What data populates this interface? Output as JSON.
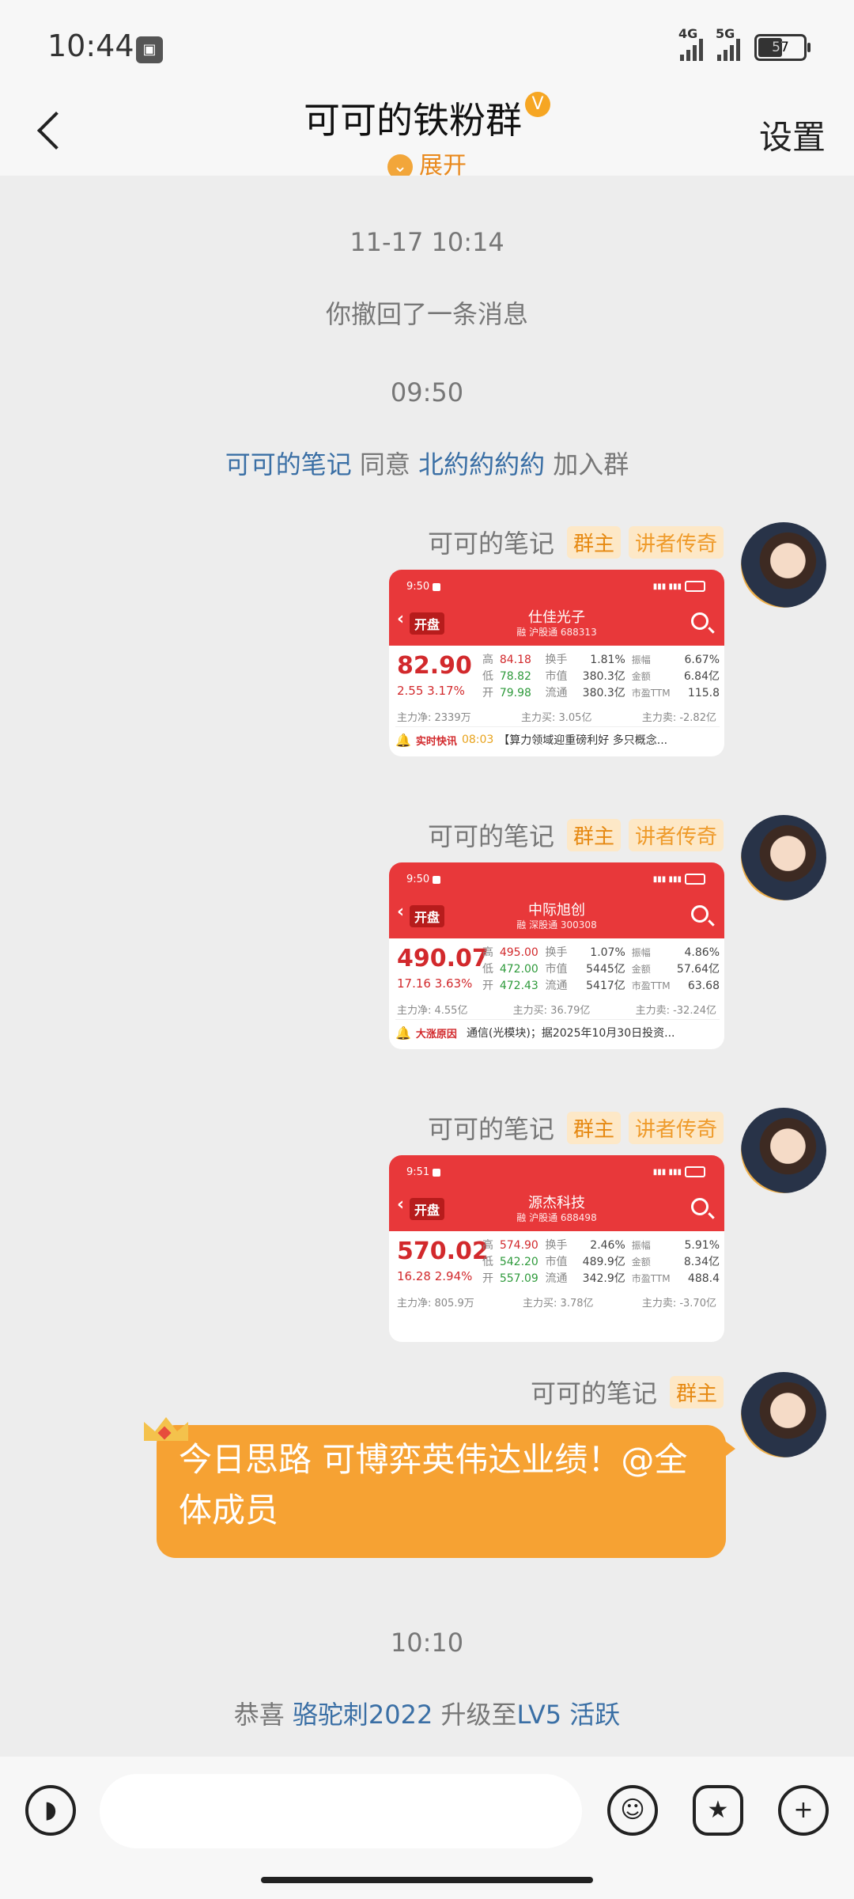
{
  "status": {
    "time": "10:44",
    "battery": "57",
    "sig1": "4G",
    "sig2": "5G",
    "notif_icon": "notification-icon"
  },
  "header": {
    "title": "可可的铁粉群",
    "verified_icon": "V",
    "expand_label": "展开",
    "settings_label": "设置"
  },
  "messages": {
    "time1": "11-17 10:14",
    "recall": "你撤回了一条消息",
    "time2": "09:50",
    "join": {
      "who": "可可的笔记",
      "verb": "同意",
      "target": "北約約約約",
      "tail": "加入群"
    },
    "sender_name": "可可的笔记",
    "badge_owner": "群主",
    "badge_speaker": "讲者传奇",
    "bubble_text": "今日思路  可博弈英伟达业绩！@全体成员",
    "time3": "10:10",
    "upgrade": {
      "prefix": "恭喜",
      "user": "骆驼刺2022",
      "mid": "升级至",
      "level": "LV5 活跃"
    }
  },
  "cards": [
    {
      "time": "9:50",
      "open": "开盘",
      "name": "仕佳光子",
      "market": "融 沪股通 688313",
      "price": "82.90",
      "change": "2.55  3.17%",
      "rows": [
        [
          "高",
          "84.18",
          "换手",
          "1.81%",
          "振幅",
          "6.67%"
        ],
        [
          "低",
          "78.82",
          "市值",
          "380.3亿",
          "金额",
          "6.84亿"
        ],
        [
          "开",
          "79.98",
          "流通",
          "380.3亿",
          "市盈TTM",
          "115.8"
        ]
      ],
      "flow": [
        "主力净: 2339万",
        "主力买: 3.05亿",
        "主力卖: -2.82亿"
      ],
      "news_src": "实时快讯",
      "news_time": "08:03",
      "news_text": "【算力领域迎重磅利好 多只概念..."
    },
    {
      "time": "9:50",
      "open": "开盘",
      "name": "中际旭创",
      "market": "融 深股通 300308",
      "price": "490.07",
      "change": "17.16  3.63%",
      "rows": [
        [
          "高",
          "495.00",
          "换手",
          "1.07%",
          "振幅",
          "4.86%"
        ],
        [
          "低",
          "472.00",
          "市值",
          "5445亿",
          "金额",
          "57.64亿"
        ],
        [
          "开",
          "472.43",
          "流通",
          "5417亿",
          "市盈TTM",
          "63.68"
        ]
      ],
      "flow": [
        "主力净: 4.55亿",
        "主力买: 36.79亿",
        "主力卖: -32.24亿"
      ],
      "news_src": "大涨原因",
      "news_time": "",
      "news_text": "通信(光模块)；据2025年10月30日投资..."
    },
    {
      "time": "9:51",
      "open": "开盘",
      "name": "源杰科技",
      "market": "融 沪股通 688498",
      "price": "570.02",
      "change": "16.28  2.94%",
      "rows": [
        [
          "高",
          "574.90",
          "换手",
          "2.46%",
          "振幅",
          "5.91%"
        ],
        [
          "低",
          "542.20",
          "市值",
          "489.9亿",
          "金额",
          "8.34亿"
        ],
        [
          "开",
          "557.09",
          "流通",
          "342.9亿",
          "市盈TTM",
          "488.4"
        ]
      ],
      "flow": [
        "主力净: 805.9万",
        "主力买: 3.78亿",
        "主力卖: -3.70亿"
      ],
      "news_src": "",
      "news_time": "",
      "news_text": ""
    }
  ],
  "inputbar": {
    "voice_icon": "voice-icon",
    "emoji_icon": "emoji-icon",
    "sticker_icon": "sticker-icon",
    "plus_icon": "plus-icon"
  }
}
